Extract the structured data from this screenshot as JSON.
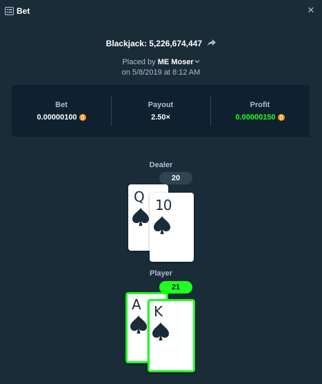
{
  "window": {
    "title": "Bet",
    "close_icon": "close-icon",
    "title_icon": "bet-slip-icon"
  },
  "game": {
    "name_and_id": "Blackjack: 5,226,674,447",
    "share_icon": "share-icon"
  },
  "placed": {
    "prefix": "Placed by",
    "user": "ME Moser",
    "date": "on 5/8/2019 at 8:12 AM"
  },
  "stats": {
    "bet_label": "Bet",
    "bet_value": "0.00000100",
    "payout_label": "Payout",
    "payout_value": "2.50×",
    "profit_label": "Profit",
    "profit_value": "0.00000150",
    "currency_icon": "bitcoin-icon"
  },
  "dealer": {
    "label": "Dealer",
    "score": "20",
    "cards": [
      {
        "rank": "Q",
        "suit": "spades"
      },
      {
        "rank": "10",
        "suit": "spades"
      }
    ]
  },
  "player": {
    "label": "Player",
    "score": "21",
    "cards": [
      {
        "rank": "A",
        "suit": "spades"
      },
      {
        "rank": "K",
        "suit": "spades"
      }
    ]
  },
  "colors": {
    "background": "#1a2c38",
    "panel": "#0f212e",
    "win_green": "#1fff20",
    "muted_text": "#b1bad3",
    "card_ink": "#1a2c38",
    "badge_neutral": "#2f4553",
    "coin": "#f7931a"
  }
}
